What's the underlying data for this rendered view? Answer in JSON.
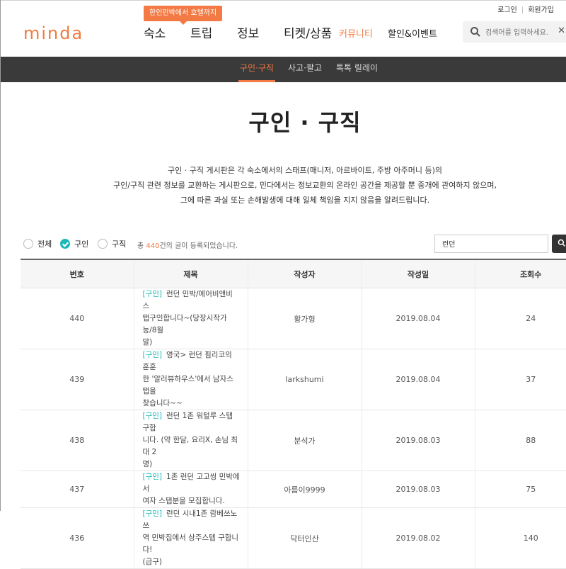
{
  "header": {
    "logo": "minda",
    "login": "로그인",
    "signup": "회원가입",
    "tooltip": "한인민박에서 호텔까지",
    "nav": [
      "숙소",
      "트립",
      "정보",
      "티켓/상품",
      "커뮤니티",
      "할인&이벤트"
    ],
    "search_placeholder": "검색어를 입력하세요.",
    "search_clear": "✕"
  },
  "subnav": [
    "구인·구직",
    "사고·팔고",
    "톡톡 릴레이"
  ],
  "page_title": "구인 · 구직",
  "description": [
    "구인 · 구직 게시판은 각 숙소에서의 스태프(매니저, 아르바이트, 주방 아주머니 등)의",
    "구인/구직 관련 정보를 교환하는 게시판으로, 민다에서는 정보교환의 온라인 공간을 제공할 뿐 중개에 관여하지 않으며,",
    "그에 따른 과실 또는 손해발생에 대해 일체 책임을 지지 않음을 알려드립니다."
  ],
  "filters": {
    "options": [
      "전체",
      "구인",
      "구직"
    ],
    "selected": "구인",
    "count_prefix": "총 ",
    "count": "440",
    "count_suffix": "건의 글이 등록되었습니다.",
    "search_value": "런던"
  },
  "table": {
    "headers": [
      "번호",
      "제목",
      "작성자",
      "작성일",
      "조회수"
    ],
    "rows": [
      {
        "no": "440",
        "tag": "[구인]",
        "title": "런던 민박/에어비앤비 스탭구인합니다~(당장시작가능/8월말)",
        "lines": [
          "런던 민박/에어비앤비 스",
          "탭구인합니다~(당장시작가능/8월",
          "말)"
        ],
        "author": "황가형",
        "date": "2019.08.04",
        "views": "24"
      },
      {
        "no": "439",
        "tag": "[구인]",
        "title": "영국> 런던 핌리코의 훈훈한 '알러뷰하우스'에서 남자스탭을 찾습니다~~",
        "lines": [
          "영국> 런던 핌리코의 훈훈",
          "한 '알러뷰하우스'에서 남자스탭을",
          "찾습니다~~"
        ],
        "author": "larkshumi",
        "date": "2019.08.04",
        "views": "37"
      },
      {
        "no": "438",
        "tag": "[구인]",
        "title": "런던 1존 워털루 스탭 구합니다. (약 한달, 요리X, 손님 최대 2명)",
        "lines": [
          "런던 1존 워털루 스탭 구합",
          "니다. (약 한달, 요리X, 손님 최대 2",
          "명)"
        ],
        "author": "분석가",
        "date": "2019.08.03",
        "views": "88"
      },
      {
        "no": "437",
        "tag": "[구인]",
        "title": "1존 런던 고고씽 민박에서 여자 스탭분을 모집합니다.",
        "lines": [
          "1존 런던 고고씽 민박에서",
          "여자 스탭분을 모집합니다."
        ],
        "author": "아름이9999",
        "date": "2019.08.03",
        "views": "75"
      },
      {
        "no": "436",
        "tag": "[구인]",
        "title": "런던 시내1존 람베쓰노쓰역 민박집에서 상주스텝 구합니다!(급구)",
        "lines": [
          "런던 시내1존 람베쓰노쓰",
          "역 민박집에서 상주스텝 구합니다!",
          "(급구)"
        ],
        "author": "닥터인산",
        "date": "2019.08.02",
        "views": "140"
      }
    ]
  }
}
